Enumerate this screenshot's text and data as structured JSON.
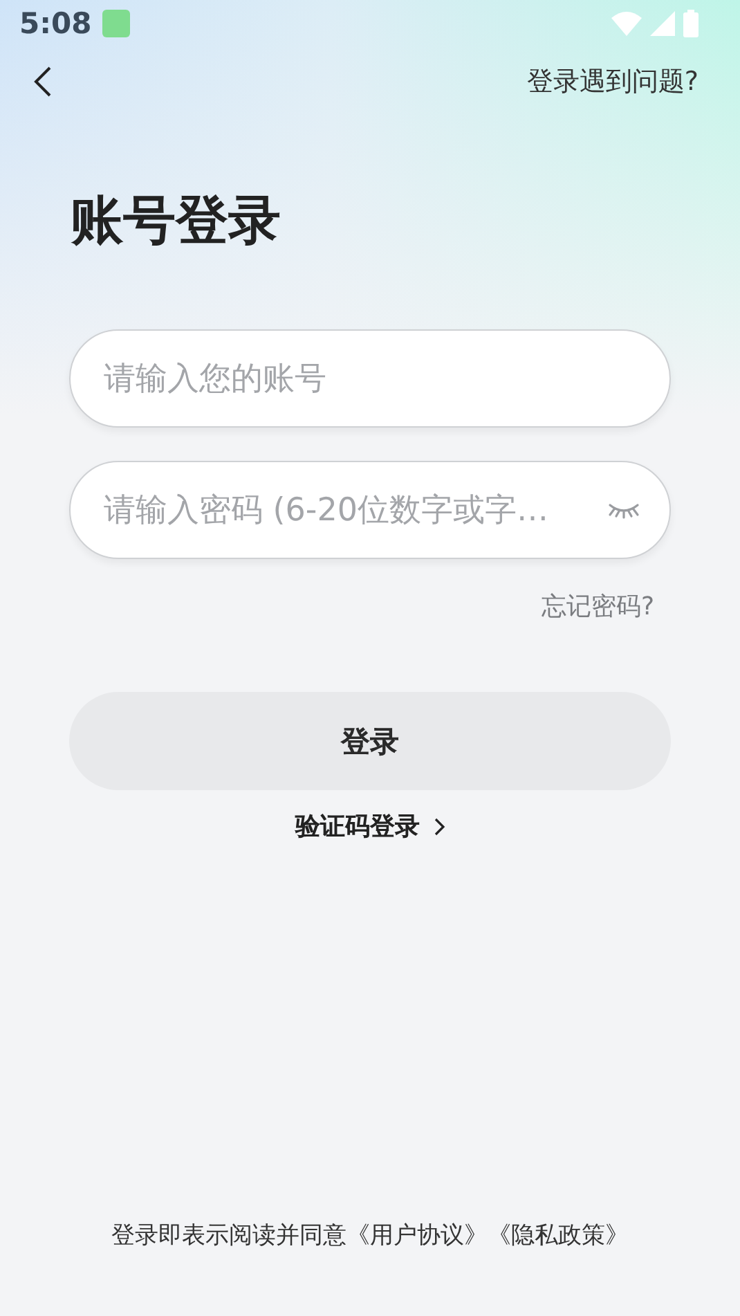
{
  "status_bar": {
    "time": "5:08"
  },
  "header": {
    "help_link": "登录遇到问题?"
  },
  "title": "账号登录",
  "fields": [
    {
      "kind": "text",
      "placeholder": "请输入您的账号"
    },
    {
      "kind": "password",
      "placeholder": "请输入密码 (6-20位数字或字…"
    }
  ],
  "forgot_link": "忘记密码?",
  "login_button": {
    "label": "登录",
    "disabled": true
  },
  "sms_login_link": "验证码登录",
  "footer": {
    "text": "登录即表示阅读并同意",
    "links": [
      "《用户协议》",
      "《隐私政策》"
    ]
  }
}
